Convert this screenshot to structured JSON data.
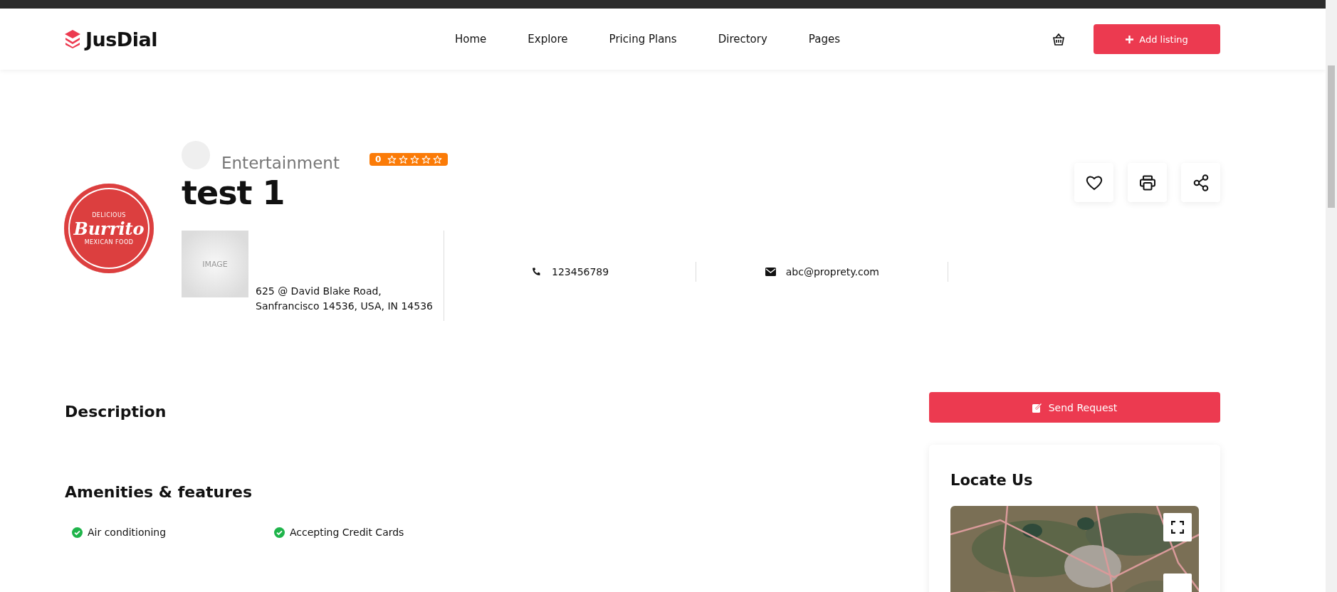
{
  "header": {
    "brand": "JusDial",
    "nav": [
      {
        "label": "Home"
      },
      {
        "label": "Explore"
      },
      {
        "label": "Pricing Plans"
      },
      {
        "label": "Directory"
      },
      {
        "label": "Pages"
      }
    ],
    "cta": "Add listing"
  },
  "listing": {
    "logo": {
      "top": "DELICIOUS",
      "script": "Burrito",
      "bottom": "MEXICAN FOOD"
    },
    "category": "Entertainment",
    "rating": {
      "score": "0",
      "stars": 0
    },
    "title": "test 1",
    "image_placeholder": "IMAGE",
    "address": "625 @ David Blake Road, Sanfrancisco 14536, USA, IN 14536",
    "phone": "123456789",
    "email": "abc@proprety.com"
  },
  "description": {
    "heading": "Description"
  },
  "amenities": {
    "heading": "Amenities & features",
    "items": [
      {
        "label": "Air conditioning"
      },
      {
        "label": "Accepting Credit Cards"
      }
    ]
  },
  "sidebar": {
    "request_button": "Send Request",
    "locate": {
      "heading": "Locate Us"
    }
  }
}
